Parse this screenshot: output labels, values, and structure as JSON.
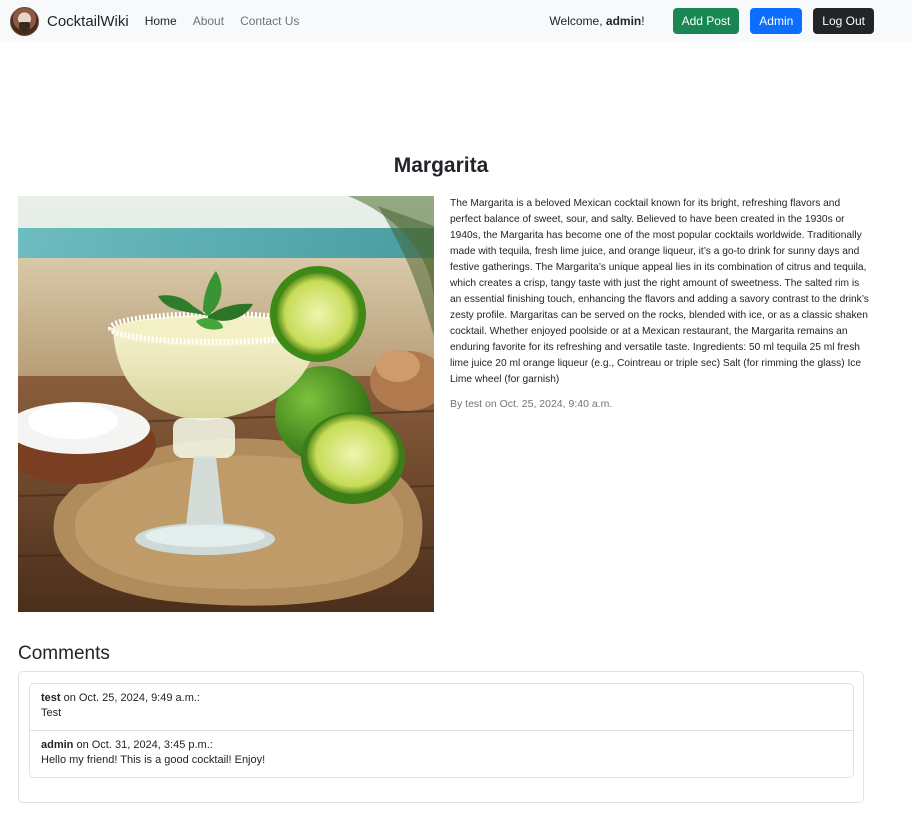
{
  "nav": {
    "brand": "CocktailWiki",
    "links": [
      "Home",
      "About",
      "Contact Us"
    ],
    "welcome_prefix": "Welcome, ",
    "welcome_user": "admin",
    "welcome_suffix": "!",
    "buttons": {
      "add_post": "Add Post",
      "admin": "Admin",
      "logout": "Log Out"
    },
    "colors": {
      "add_post": "#198754",
      "admin": "#0d6efd",
      "logout": "#212529"
    }
  },
  "post": {
    "title": "Margarita",
    "image_icon": "margarita-cocktail-photo",
    "body": "The Margarita is a beloved Mexican cocktail known for its bright, refreshing flavors and perfect balance of sweet, sour, and salty. Believed to have been created in the 1930s or 1940s, the Margarita has become one of the most popular cocktails worldwide. Traditionally made with tequila, fresh lime juice, and orange liqueur, it’s a go-to drink for sunny days and festive gatherings. The Margarita’s unique appeal lies in its combination of citrus and tequila, which creates a crisp, tangy taste with just the right amount of sweetness. The salted rim is an essential finishing touch, enhancing the flavors and adding a savory contrast to the drink’s zesty profile. Margaritas can be served on the rocks, blended with ice, or as a classic shaken cocktail. Whether enjoyed poolside or at a Mexican restaurant, the Margarita remains an enduring favorite for its refreshing and versatile taste. Ingredients: 50 ml tequila 25 ml fresh lime juice 20 ml orange liqueur (e.g., Cointreau or triple sec) Salt (for rimming the glass) Ice Lime wheel (for garnish)",
    "meta": "By test on Oct. 25, 2024, 9:40 a.m."
  },
  "comments": {
    "heading": "Comments",
    "items": [
      {
        "author": "test",
        "date": " on Oct. 25, 2024, 9:49 a.m.:",
        "text": "Test"
      },
      {
        "author": "admin",
        "date": " on Oct. 31, 2024, 3:45 p.m.:",
        "text": "Hello my friend! This is a good cocktail! Enjoy!"
      }
    ]
  }
}
